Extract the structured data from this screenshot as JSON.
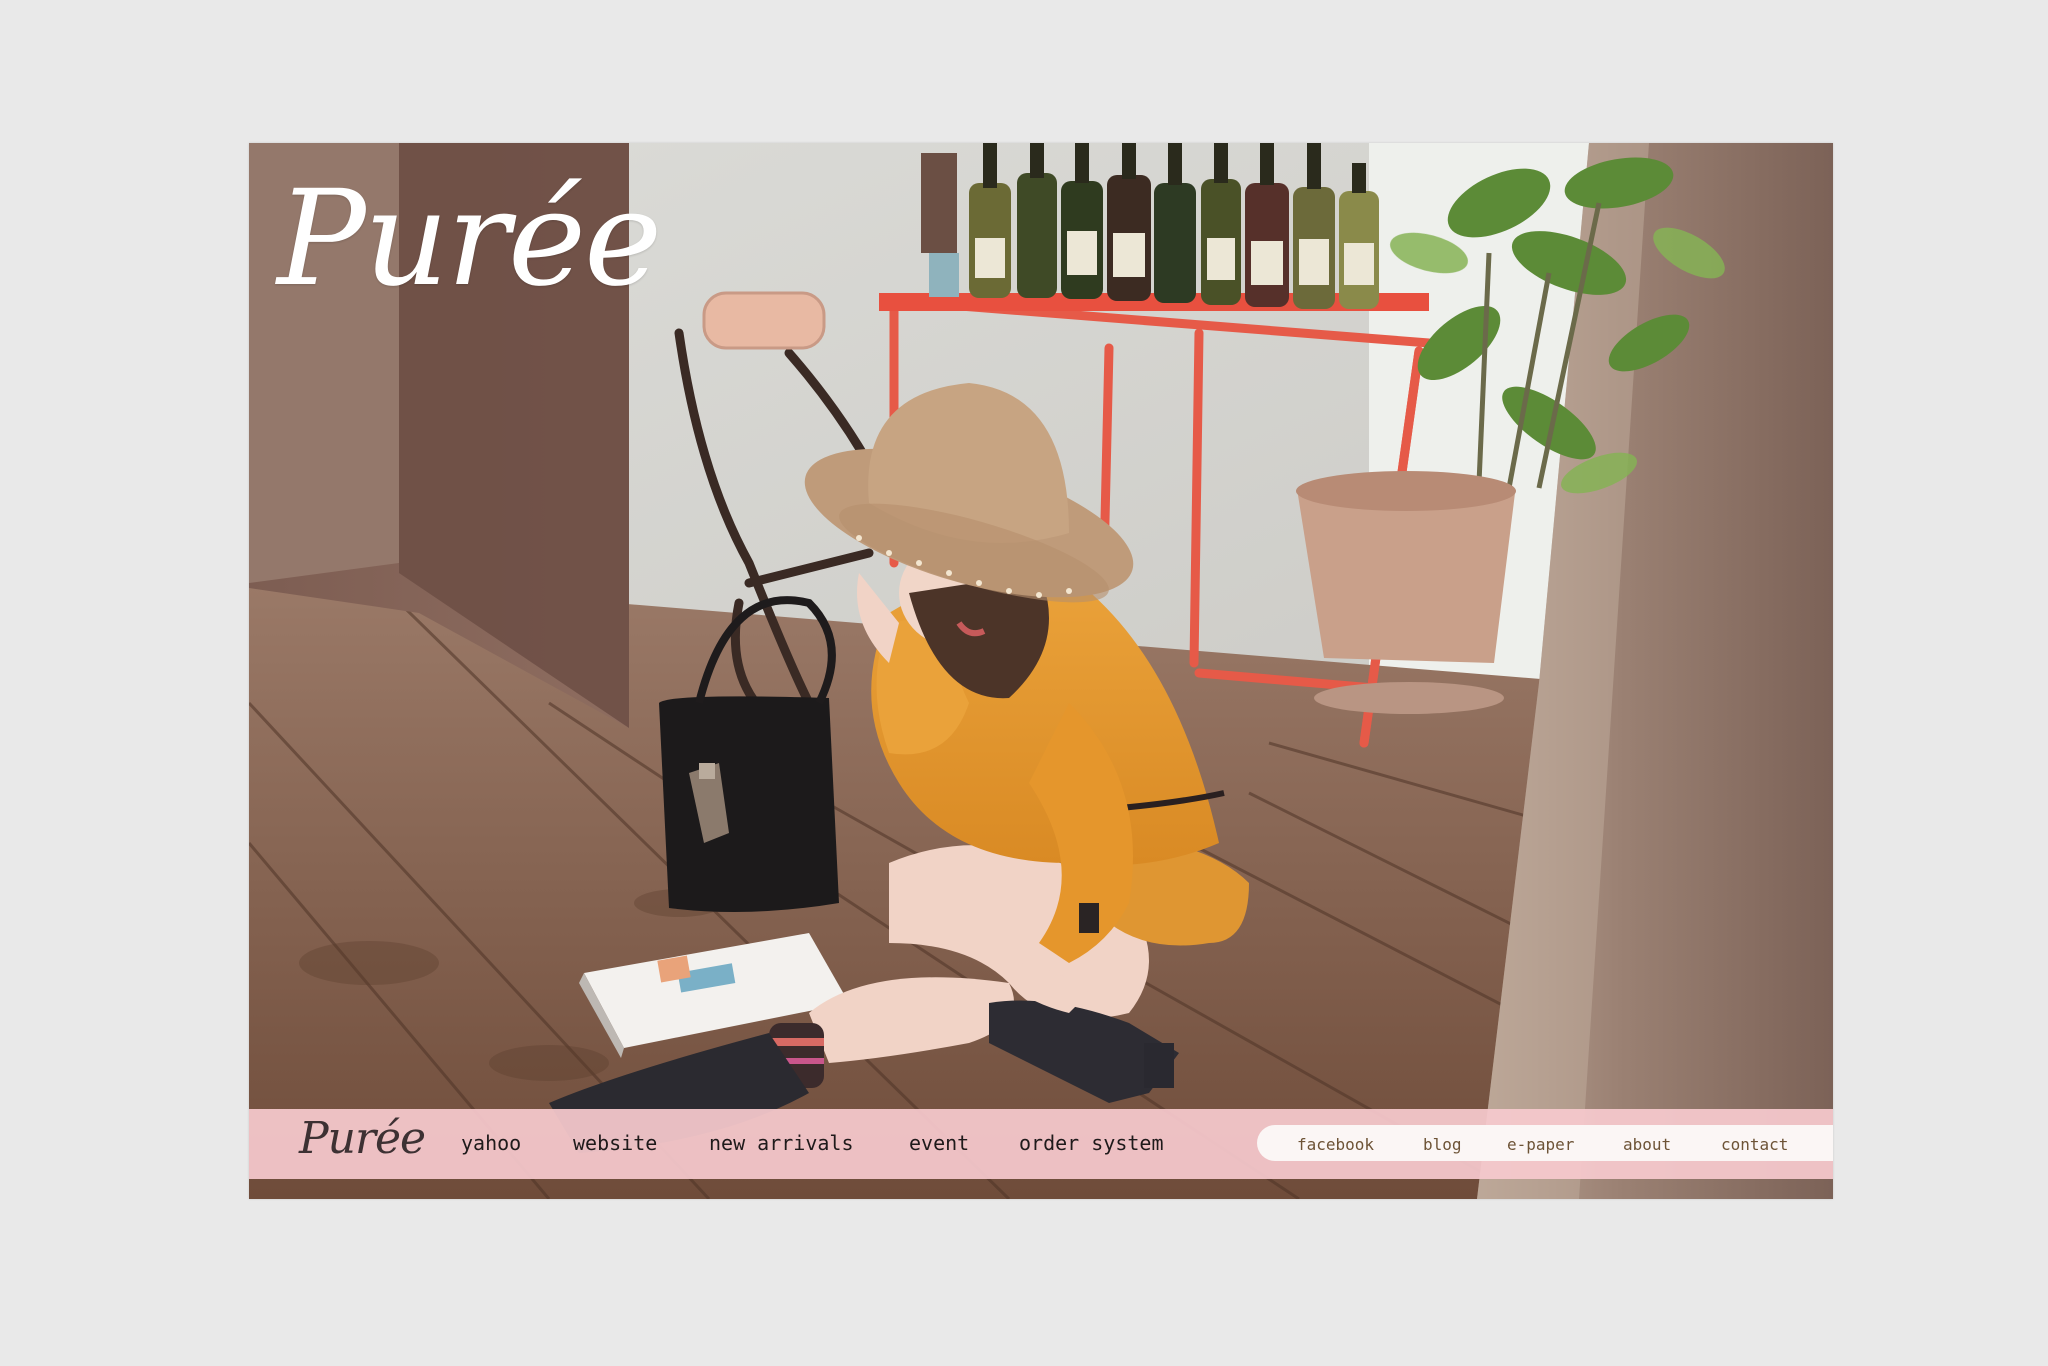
{
  "brand": {
    "logo_text": "Purée"
  },
  "nav": {
    "logo_text": "Purée",
    "primary": [
      "yahoo",
      "website",
      "new arrivals",
      "event",
      "order system"
    ],
    "secondary": [
      "facebook",
      "blog",
      "e-paper",
      "about",
      "contact"
    ]
  },
  "colors": {
    "page_bg": "#e9e9e9",
    "nav_bg": "#f6c9ce",
    "secondary_text": "#6d5336",
    "accent_shirt": "#e99a2e",
    "accent_table": "#e8503f"
  },
  "hero_image": {
    "icon": "woman-reading-magazine-photo"
  }
}
